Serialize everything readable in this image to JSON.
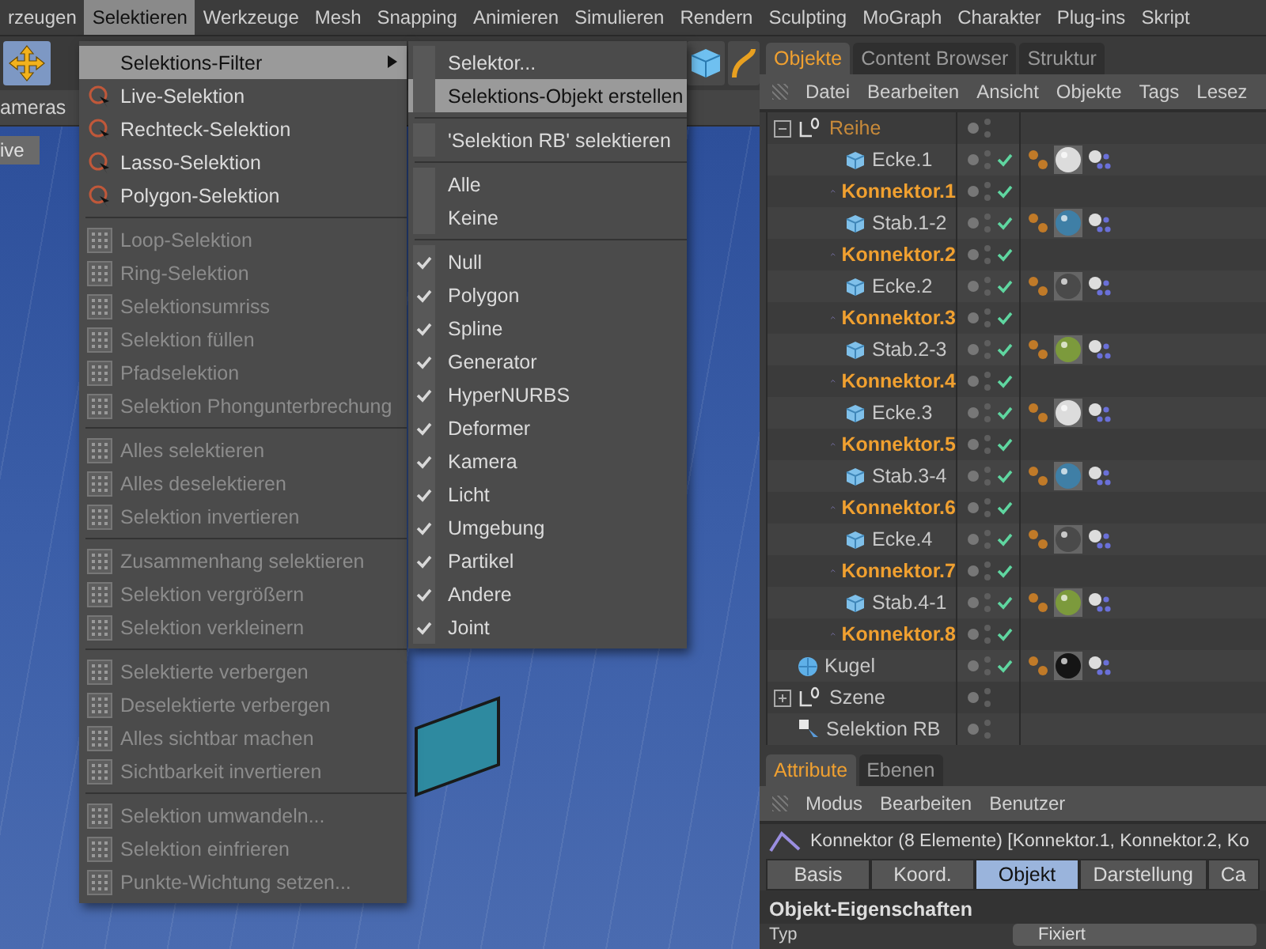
{
  "menubar": {
    "items": [
      {
        "label": "rzeugen",
        "selected": false
      },
      {
        "label": "Selektieren",
        "selected": true
      },
      {
        "label": "Werkzeuge",
        "selected": false
      },
      {
        "label": "Mesh",
        "selected": false
      },
      {
        "label": "Snapping",
        "selected": false
      },
      {
        "label": "Animieren",
        "selected": false
      },
      {
        "label": "Simulieren",
        "selected": false
      },
      {
        "label": "Rendern",
        "selected": false
      },
      {
        "label": "Sculpting",
        "selected": false
      },
      {
        "label": "MoGraph",
        "selected": false
      },
      {
        "label": "Charakter",
        "selected": false
      },
      {
        "label": "Plug-ins",
        "selected": false
      },
      {
        "label": "Skript",
        "selected": false
      }
    ]
  },
  "viewport": {
    "menu_label": "ameras",
    "mode_label": "ive"
  },
  "menu": {
    "sections": [
      [
        {
          "label": "Selektions-Filter",
          "kind": "submenu",
          "disabled": false,
          "selected": true
        },
        {
          "label": "Live-Selektion",
          "kind": "select-tool",
          "disabled": false,
          "selected": false
        },
        {
          "label": "Rechteck-Selektion",
          "kind": "select-tool",
          "disabled": false,
          "selected": false
        },
        {
          "label": "Lasso-Selektion",
          "kind": "select-tool",
          "disabled": false,
          "selected": false
        },
        {
          "label": "Polygon-Selektion",
          "kind": "select-tool",
          "disabled": false,
          "selected": false
        }
      ],
      [
        {
          "label": "Loop-Selektion",
          "kind": "command",
          "disabled": true,
          "selected": false
        },
        {
          "label": "Ring-Selektion",
          "kind": "command",
          "disabled": true,
          "selected": false
        },
        {
          "label": "Selektionsumriss",
          "kind": "command",
          "disabled": true,
          "selected": false
        },
        {
          "label": "Selektion füllen",
          "kind": "command",
          "disabled": true,
          "selected": false
        },
        {
          "label": "Pfadselektion",
          "kind": "command",
          "disabled": true,
          "selected": false
        },
        {
          "label": "Selektion Phongunterbrechung",
          "kind": "command",
          "disabled": true,
          "selected": false
        }
      ],
      [
        {
          "label": "Alles selektieren",
          "kind": "command",
          "disabled": true,
          "selected": false
        },
        {
          "label": "Alles deselektieren",
          "kind": "command",
          "disabled": true,
          "selected": false
        },
        {
          "label": "Selektion invertieren",
          "kind": "command",
          "disabled": true,
          "selected": false
        }
      ],
      [
        {
          "label": "Zusammenhang selektieren",
          "kind": "command",
          "disabled": true,
          "selected": false
        },
        {
          "label": "Selektion vergrößern",
          "kind": "command",
          "disabled": true,
          "selected": false
        },
        {
          "label": "Selektion verkleinern",
          "kind": "command",
          "disabled": true,
          "selected": false
        }
      ],
      [
        {
          "label": "Selektierte verbergen",
          "kind": "command",
          "disabled": true,
          "selected": false
        },
        {
          "label": "Deselektierte verbergen",
          "kind": "command",
          "disabled": true,
          "selected": false
        },
        {
          "label": "Alles sichtbar machen",
          "kind": "command",
          "disabled": true,
          "selected": false
        },
        {
          "label": "Sichtbarkeit invertieren",
          "kind": "command",
          "disabled": true,
          "selected": false
        }
      ],
      [
        {
          "label": "Selektion umwandeln...",
          "kind": "command",
          "disabled": true,
          "selected": false
        },
        {
          "label": "Selektion einfrieren",
          "kind": "command",
          "disabled": true,
          "selected": false
        },
        {
          "label": "Punkte-Wichtung setzen...",
          "kind": "command",
          "disabled": true,
          "selected": false
        }
      ]
    ]
  },
  "submenu": {
    "sections": [
      [
        {
          "label": "Selektor...",
          "kind": "action",
          "selected": false
        },
        {
          "label": "Selektions-Objekt erstellen",
          "kind": "action",
          "selected": true
        }
      ],
      [
        {
          "label": "'Selektion RB' selektieren",
          "kind": "action",
          "selected": false
        }
      ],
      [
        {
          "label": "Alle",
          "kind": "action",
          "selected": false
        },
        {
          "label": "Keine",
          "kind": "action",
          "selected": false
        }
      ],
      [
        {
          "label": "Null",
          "kind": "toggle",
          "checked": true,
          "selected": false
        },
        {
          "label": "Polygon",
          "kind": "toggle",
          "checked": true,
          "selected": false
        },
        {
          "label": "Spline",
          "kind": "toggle",
          "checked": true,
          "selected": false
        },
        {
          "label": "Generator",
          "kind": "toggle",
          "checked": true,
          "selected": false
        },
        {
          "label": "HyperNURBS",
          "kind": "toggle",
          "checked": true,
          "selected": false
        },
        {
          "label": "Deformer",
          "kind": "toggle",
          "checked": true,
          "selected": false
        },
        {
          "label": "Kamera",
          "kind": "toggle",
          "checked": true,
          "selected": false
        },
        {
          "label": "Licht",
          "kind": "toggle",
          "checked": true,
          "selected": false
        },
        {
          "label": "Umgebung",
          "kind": "toggle",
          "checked": true,
          "selected": false
        },
        {
          "label": "Partikel",
          "kind": "toggle",
          "checked": true,
          "selected": false
        },
        {
          "label": "Andere",
          "kind": "toggle",
          "checked": true,
          "selected": false
        },
        {
          "label": "Joint",
          "kind": "toggle",
          "checked": true,
          "selected": false
        }
      ]
    ]
  },
  "object_manager": {
    "tabs": [
      {
        "label": "Objekte",
        "selected": true
      },
      {
        "label": "Content Browser",
        "selected": false
      },
      {
        "label": "Struktur",
        "selected": false
      }
    ],
    "menu": [
      "Datei",
      "Bearbeiten",
      "Ansicht",
      "Objekte",
      "Tags",
      "Lesez"
    ],
    "tree": [
      {
        "name": "Reihe",
        "kind": "null",
        "selected": false,
        "child_selected": true,
        "checked": false,
        "expanded": true,
        "children": [
          {
            "name": "Ecke.1",
            "kind": "cube",
            "selected": false,
            "checked": true,
            "color": "#dcdcdc"
          },
          {
            "name": "Konnektor.1",
            "kind": "spline",
            "selected": true,
            "checked": true
          },
          {
            "name": "Stab.1-2",
            "kind": "cube",
            "selected": false,
            "checked": true,
            "color": "#3f7fa6"
          },
          {
            "name": "Konnektor.2",
            "kind": "spline",
            "selected": true,
            "checked": true
          },
          {
            "name": "Ecke.2",
            "kind": "cube",
            "selected": false,
            "checked": true,
            "color": "#4a4a4a"
          },
          {
            "name": "Konnektor.3",
            "kind": "spline",
            "selected": true,
            "checked": true
          },
          {
            "name": "Stab.2-3",
            "kind": "cube",
            "selected": false,
            "checked": true,
            "color": "#7c9a3c"
          },
          {
            "name": "Konnektor.4",
            "kind": "spline",
            "selected": true,
            "checked": true
          },
          {
            "name": "Ecke.3",
            "kind": "cube",
            "selected": false,
            "checked": true,
            "color": "#dcdcdc"
          },
          {
            "name": "Konnektor.5",
            "kind": "spline",
            "selected": true,
            "checked": true
          },
          {
            "name": "Stab.3-4",
            "kind": "cube",
            "selected": false,
            "checked": true,
            "color": "#3f7fa6"
          },
          {
            "name": "Konnektor.6",
            "kind": "spline",
            "selected": true,
            "checked": true
          },
          {
            "name": "Ecke.4",
            "kind": "cube",
            "selected": false,
            "checked": true,
            "color": "#4a4a4a"
          },
          {
            "name": "Konnektor.7",
            "kind": "spline",
            "selected": true,
            "checked": true
          },
          {
            "name": "Stab.4-1",
            "kind": "cube",
            "selected": false,
            "checked": true,
            "color": "#7c9a3c"
          },
          {
            "name": "Konnektor.8",
            "kind": "spline",
            "selected": true,
            "checked": true
          }
        ]
      },
      {
        "name": "Kugel",
        "kind": "sphere",
        "selected": false,
        "checked": true,
        "color": "#151515"
      },
      {
        "name": "Szene",
        "kind": "null",
        "selected": false,
        "child_selected": false,
        "checked": false,
        "expanded": false
      },
      {
        "name": "Selektion RB",
        "kind": "selection",
        "selected": false,
        "checked": false
      }
    ]
  },
  "attribute_manager": {
    "tabs": [
      {
        "label": "Attribute",
        "selected": true
      },
      {
        "label": "Ebenen",
        "selected": false
      }
    ],
    "menu": [
      "Modus",
      "Bearbeiten",
      "Benutzer"
    ],
    "title": "Konnektor (8 Elemente) [Konnektor.1, Konnektor.2, Ko",
    "page_tabs": [
      {
        "label": "Basis",
        "selected": false
      },
      {
        "label": "Koord.",
        "selected": false
      },
      {
        "label": "Objekt",
        "selected": true
      },
      {
        "label": "Darstellung",
        "selected": false
      },
      {
        "label": "Ca",
        "selected": false
      }
    ],
    "section": "Objekt-Eigenschaften",
    "field": {
      "label": "Typ",
      "value": "Fixiert"
    }
  }
}
